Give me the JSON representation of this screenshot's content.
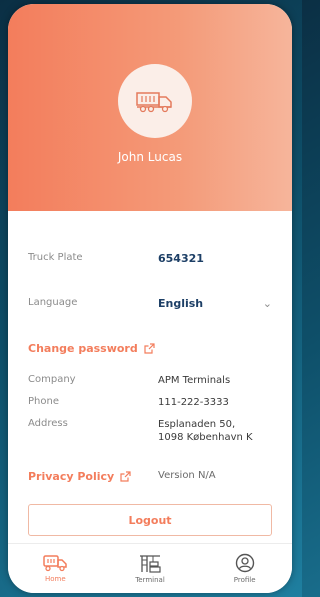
{
  "user": {
    "name": "John Lucas"
  },
  "fields": {
    "truck_plate": {
      "label": "Truck Plate",
      "value": "654321"
    },
    "language": {
      "label": "Language",
      "value": "English"
    },
    "company": {
      "label": "Company",
      "value": "APM Terminals"
    },
    "phone": {
      "label": "Phone",
      "value": "111-222-3333"
    },
    "address": {
      "label": "Address",
      "line1": "Esplanaden 50,",
      "line2": "1098 København K"
    }
  },
  "links": {
    "change_password": "Change password",
    "privacy_policy": "Privacy Policy"
  },
  "version": "Version N/A",
  "logout_label": "Logout",
  "nav": [
    {
      "label": "Home",
      "icon": "truck-icon",
      "active": true
    },
    {
      "label": "Terminal",
      "icon": "crane-icon",
      "active": false
    },
    {
      "label": "Profile",
      "icon": "profile-icon",
      "active": false
    }
  ],
  "colors": {
    "accent": "#f37d5c",
    "plate": "#1d3f66"
  }
}
